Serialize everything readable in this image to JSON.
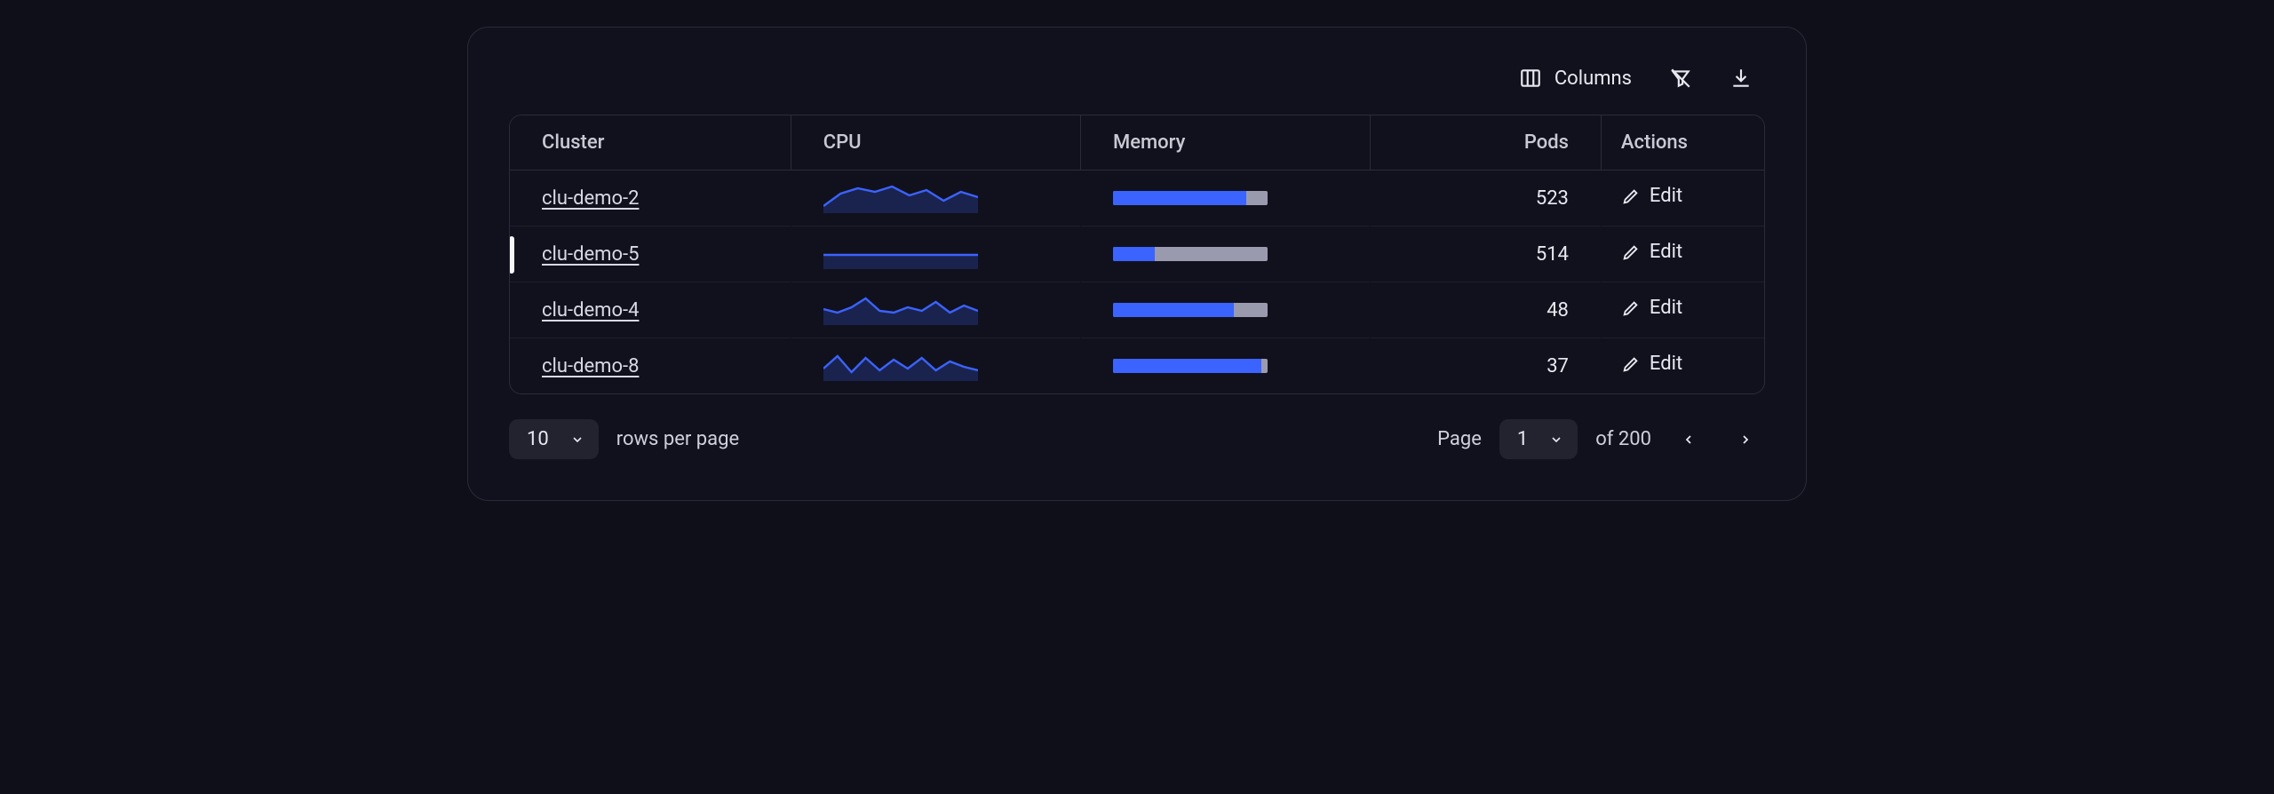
{
  "toolbar": {
    "columns_label": "Columns"
  },
  "table": {
    "headers": {
      "cluster": "Cluster",
      "cpu": "CPU",
      "memory": "Memory",
      "pods": "Pods",
      "actions": "Actions"
    },
    "rows": [
      {
        "cluster": "clu-demo-2",
        "memory_pct": 86,
        "pods": "523",
        "edit": "Edit",
        "cpu_series": [
          8,
          22,
          28,
          24,
          30,
          20,
          26,
          14,
          24,
          18
        ],
        "selected": false
      },
      {
        "cluster": "clu-demo-5",
        "memory_pct": 27,
        "pods": "514",
        "edit": "Edit",
        "cpu_series": [
          16,
          16,
          16,
          16,
          16,
          16,
          16,
          16,
          16,
          16
        ],
        "selected": true
      },
      {
        "cluster": "clu-demo-4",
        "memory_pct": 78,
        "pods": "48",
        "edit": "Edit",
        "cpu_series": [
          18,
          14,
          20,
          30,
          16,
          14,
          20,
          16,
          26,
          14,
          22,
          16
        ],
        "selected": false
      },
      {
        "cluster": "clu-demo-8",
        "memory_pct": 96,
        "pods": "37",
        "edit": "Edit",
        "cpu_series": [
          14,
          28,
          10,
          26,
          12,
          24,
          14,
          26,
          12,
          22,
          16,
          12
        ],
        "selected": false
      }
    ]
  },
  "footer": {
    "rows_per_page_value": "10",
    "rows_per_page_label": "rows per page",
    "page_label": "Page",
    "page_value": "1",
    "page_total_label": "of 200"
  },
  "chart_data": [
    {
      "type": "line",
      "title": "CPU sparkline — clu-demo-2",
      "x": [
        0,
        1,
        2,
        3,
        4,
        5,
        6,
        7,
        8,
        9
      ],
      "values": [
        8,
        22,
        28,
        24,
        30,
        20,
        26,
        14,
        24,
        18
      ],
      "ylim": [
        0,
        34
      ]
    },
    {
      "type": "line",
      "title": "CPU sparkline — clu-demo-5",
      "x": [
        0,
        1,
        2,
        3,
        4,
        5,
        6,
        7,
        8,
        9
      ],
      "values": [
        16,
        16,
        16,
        16,
        16,
        16,
        16,
        16,
        16,
        16
      ],
      "ylim": [
        0,
        34
      ]
    },
    {
      "type": "line",
      "title": "CPU sparkline — clu-demo-4",
      "x": [
        0,
        1,
        2,
        3,
        4,
        5,
        6,
        7,
        8,
        9,
        10,
        11
      ],
      "values": [
        18,
        14,
        20,
        30,
        16,
        14,
        20,
        16,
        26,
        14,
        22,
        16
      ],
      "ylim": [
        0,
        34
      ]
    },
    {
      "type": "line",
      "title": "CPU sparkline — clu-demo-8",
      "x": [
        0,
        1,
        2,
        3,
        4,
        5,
        6,
        7,
        8,
        9,
        10,
        11
      ],
      "values": [
        14,
        28,
        10,
        26,
        12,
        24,
        14,
        26,
        12,
        22,
        16,
        12
      ],
      "ylim": [
        0,
        34
      ]
    },
    {
      "type": "bar",
      "title": "Memory %",
      "categories": [
        "clu-demo-2",
        "clu-demo-5",
        "clu-demo-4",
        "clu-demo-8"
      ],
      "values": [
        86,
        27,
        78,
        96
      ],
      "ylim": [
        0,
        100
      ]
    }
  ]
}
